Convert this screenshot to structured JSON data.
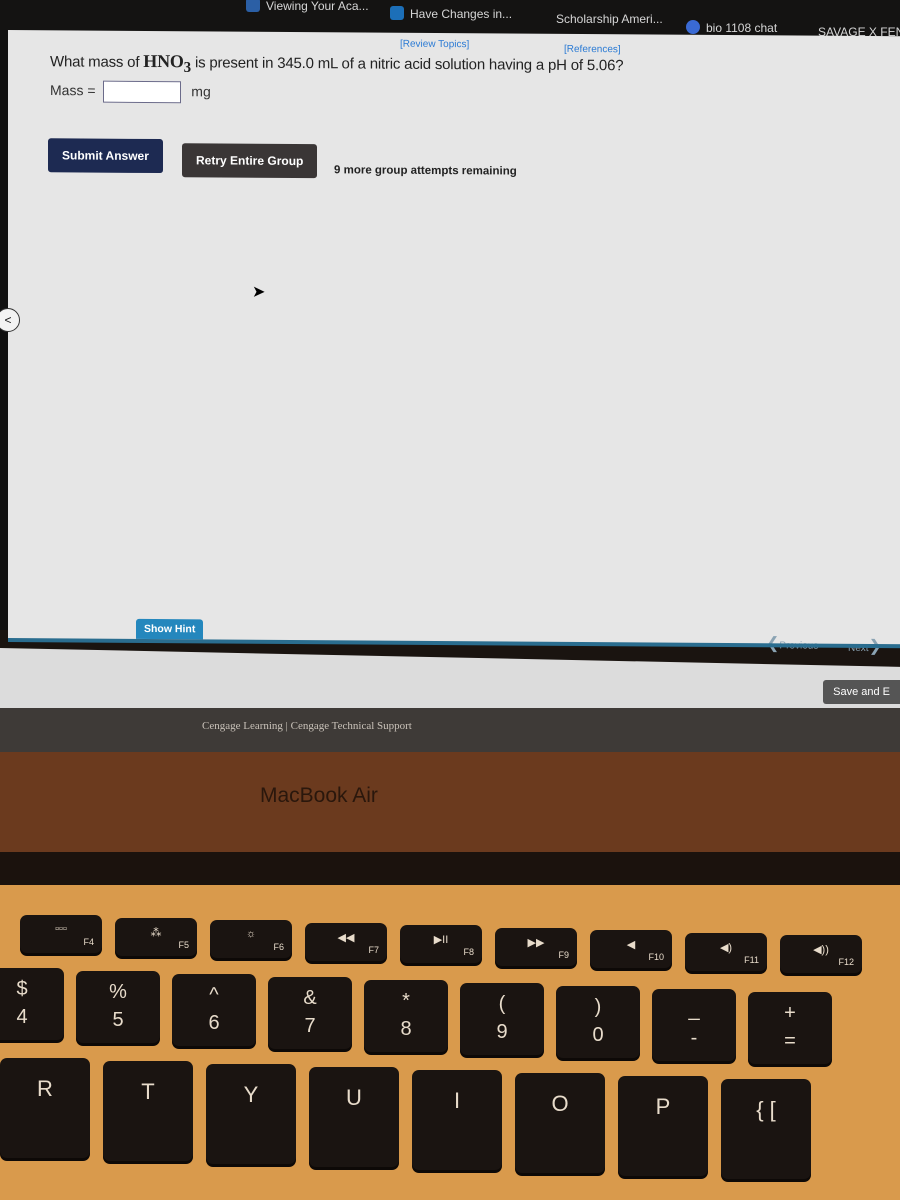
{
  "bookmarks": [
    {
      "label": "Viewing Your Aca...",
      "icon": "kb-icon"
    },
    {
      "label": "Have Changes in...",
      "icon": "doc-icon"
    },
    {
      "label": "Scholarship Ameri...",
      "icon": null
    },
    {
      "label": "bio 1108 chat",
      "icon": "chat-icon"
    },
    {
      "label": "SAVAGE X FENT",
      "icon": null
    }
  ],
  "page_links": {
    "review_topics": "[Review Topics]",
    "references": "[References]"
  },
  "question": {
    "prefix": "What mass of ",
    "chem_main": "HNO",
    "chem_sub": "3",
    "suffix": " is present in 345.0 mL of a nitric acid solution having a pH of 5.06?"
  },
  "answer": {
    "label": "Mass =",
    "value": "",
    "unit": "mg"
  },
  "buttons": {
    "submit": "Submit Answer",
    "retry": "Retry Entire Group",
    "show_hint": "Show Hint",
    "previous": "Previous",
    "next": "Next",
    "save": "Save and E"
  },
  "attempts_text": "9 more group attempts remaining",
  "footer": {
    "text": "Cengage Learning  |  Cengage Technical Support"
  },
  "laptop": {
    "brand": "MacBook Air"
  },
  "keyboard": {
    "function_row": [
      {
        "fn": "F4",
        "glyph": "▫▫▫"
      },
      {
        "fn": "F5",
        "glyph": "⁂"
      },
      {
        "fn": "F6",
        "glyph": "☼"
      },
      {
        "fn": "F7",
        "glyph": "◀◀"
      },
      {
        "fn": "F8",
        "glyph": "▶II"
      },
      {
        "fn": "F9",
        "glyph": "▶▶"
      },
      {
        "fn": "F10",
        "glyph": "◀"
      },
      {
        "fn": "F11",
        "glyph": "◀)"
      },
      {
        "fn": "F12",
        "glyph": "◀))"
      }
    ],
    "number_row": [
      {
        "top": "$",
        "bot": "4"
      },
      {
        "top": "%",
        "bot": "5"
      },
      {
        "top": "^",
        "bot": "6"
      },
      {
        "top": "&",
        "bot": "7"
      },
      {
        "top": "*",
        "bot": "8"
      },
      {
        "top": "(",
        "bot": "9"
      },
      {
        "top": ")",
        "bot": "0"
      },
      {
        "top": "_",
        "bot": "-"
      },
      {
        "top": "+",
        "bot": "="
      }
    ],
    "letter_row": [
      "R",
      "T",
      "Y",
      "U",
      "I",
      "O",
      "P",
      "{ ["
    ]
  }
}
